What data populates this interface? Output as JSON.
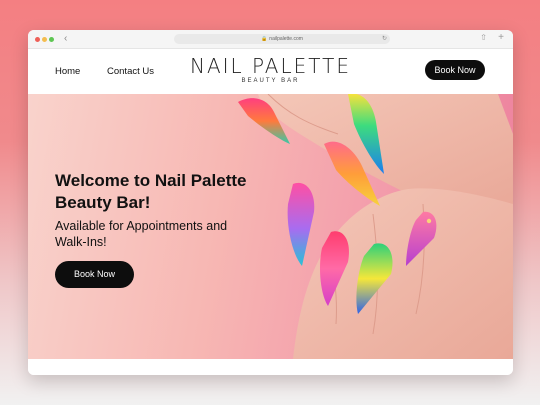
{
  "browser": {
    "url": "nailpalette.com",
    "icons": [
      "back-icon",
      "lock-icon",
      "reload-icon",
      "share-icon",
      "new-tab-icon"
    ]
  },
  "nav": {
    "home": "Home",
    "contact": "Contact Us",
    "book_now": "Book Now"
  },
  "logo": {
    "title": "NAIL PALETTE",
    "subtitle": "BEAUTY BAR"
  },
  "hero": {
    "title": "Welcome to Nail Palette Beauty Bar!",
    "subtitle": "Available for Appointments and Walk-Ins!",
    "book_now": "Book Now"
  },
  "colors": {
    "accent": "#0d0d0d",
    "hero_pink": "#f39cab",
    "page_bg": "#f47f82"
  }
}
